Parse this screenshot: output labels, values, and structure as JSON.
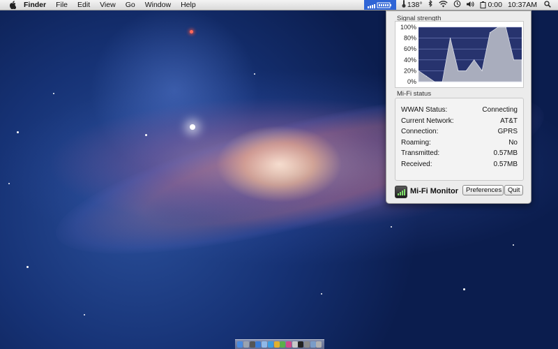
{
  "menubar": {
    "app_name": "Finder",
    "menus": [
      "File",
      "Edit",
      "View",
      "Go",
      "Window",
      "Help"
    ],
    "temperature": "138°",
    "battery_time": "0:00",
    "clock": "10:37AM"
  },
  "panel": {
    "signal_title": "Signal strength",
    "status_title": "Mi-Fi status",
    "status_rows": [
      {
        "label": "WWAN Status:",
        "value": "Connecting"
      },
      {
        "label": "Current Network:",
        "value": "AT&T"
      },
      {
        "label": "Connection:",
        "value": "GPRS"
      },
      {
        "label": "Roaming:",
        "value": "No"
      },
      {
        "label": "Transmitted:",
        "value": "0.57MB"
      },
      {
        "label": "Received:",
        "value": "0.57MB"
      }
    ],
    "app_name": "Mi-Fi Monitor",
    "preferences_label": "Preferences",
    "quit_label": "Quit"
  },
  "chart_data": {
    "type": "area",
    "ylim": [
      0,
      100
    ],
    "yticks": [
      "100%",
      "80%",
      "60%",
      "40%",
      "20%",
      "0%"
    ],
    "values": [
      20,
      10,
      0,
      0,
      80,
      20,
      20,
      40,
      20,
      90,
      100,
      100,
      40,
      40
    ],
    "colors": {
      "fill": "#a9adbd",
      "background": "#27336e",
      "grid": "#7a86c2"
    }
  },
  "colors": {
    "accent": "#2f65d6"
  }
}
